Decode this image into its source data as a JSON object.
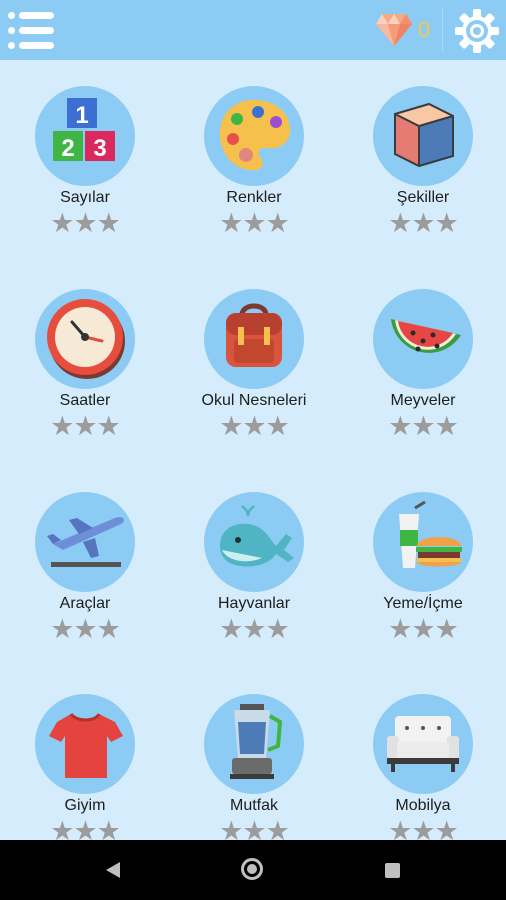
{
  "header": {
    "menu_icon": "menu-list-icon",
    "gem_icon": "diamond-icon",
    "gem_count": "0",
    "settings_icon": "gear-icon"
  },
  "colors": {
    "background": "#d4ecfb",
    "topbar": "#8ccbf3",
    "circle": "#8ccbf3",
    "star": "#9c9c9c",
    "gem_count": "#f7c84a"
  },
  "categories": [
    {
      "label": "Sayılar",
      "icon": "number-blocks-icon",
      "stars": "★★★"
    },
    {
      "label": "Renkler",
      "icon": "paint-palette-icon",
      "stars": "★★★"
    },
    {
      "label": "Şekiller",
      "icon": "cube-icon",
      "stars": "★★★"
    },
    {
      "label": "Saatler",
      "icon": "clock-icon",
      "stars": "★★★"
    },
    {
      "label": "Okul Nesneleri",
      "icon": "backpack-icon",
      "stars": "★★★"
    },
    {
      "label": "Meyveler",
      "icon": "watermelon-icon",
      "stars": "★★★"
    },
    {
      "label": "Araçlar",
      "icon": "airplane-icon",
      "stars": "★★★"
    },
    {
      "label": "Hayvanlar",
      "icon": "whale-icon",
      "stars": "★★★"
    },
    {
      "label": "Yeme/İçme",
      "icon": "burger-drink-icon",
      "stars": "★★★"
    },
    {
      "label": "Giyim",
      "icon": "tshirt-icon",
      "stars": "★★★"
    },
    {
      "label": "Mutfak",
      "icon": "blender-icon",
      "stars": "★★★"
    },
    {
      "label": "Mobilya",
      "icon": "sofa-icon",
      "stars": "★★★"
    }
  ],
  "navbar": {
    "back_icon": "back-triangle-icon",
    "home_icon": "home-circle-icon",
    "recent_icon": "recent-square-icon"
  }
}
